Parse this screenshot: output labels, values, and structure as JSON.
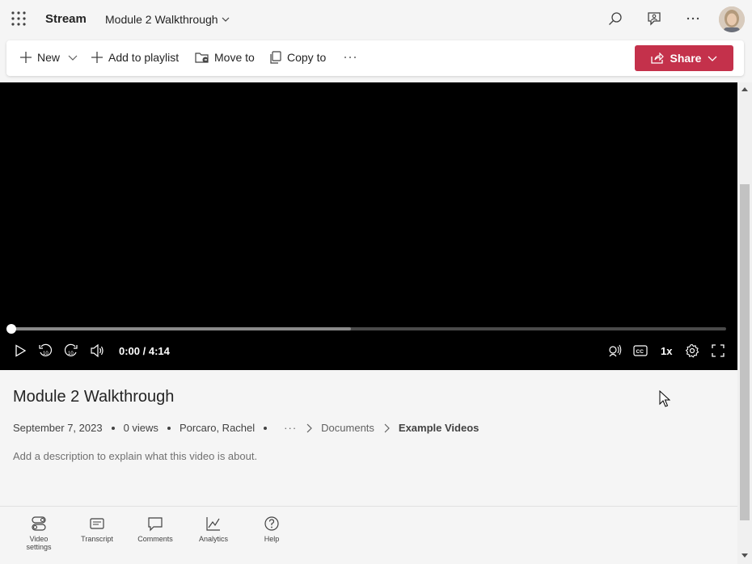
{
  "app": {
    "name": "Stream"
  },
  "breadcrumb": {
    "title": "Module 2 Walkthrough"
  },
  "commands": {
    "new": "New",
    "add_to_playlist": "Add to playlist",
    "move_to": "Move to",
    "copy_to": "Copy to",
    "share": "Share"
  },
  "player": {
    "time": "0:00 / 4:14",
    "progress": 0,
    "buffered": 0.475,
    "speed": "1x"
  },
  "video": {
    "title": "Module 2 Walkthrough",
    "date": "September 7, 2023",
    "views": "0 views",
    "author": "Porcaro, Rachel",
    "ellipsis": "···",
    "path": [
      "Documents",
      "Example Videos"
    ],
    "description_placeholder": "Add a description to explain what this video is about."
  },
  "tabs": [
    {
      "label": "Video settings",
      "icon": "toggle-icon"
    },
    {
      "label": "Transcript",
      "icon": "transcript-icon"
    },
    {
      "label": "Comments",
      "icon": "comment-icon"
    },
    {
      "label": "Analytics",
      "icon": "analytics-icon"
    },
    {
      "label": "Help",
      "icon": "help-icon"
    }
  ],
  "colors": {
    "accent": "#c4314b"
  }
}
